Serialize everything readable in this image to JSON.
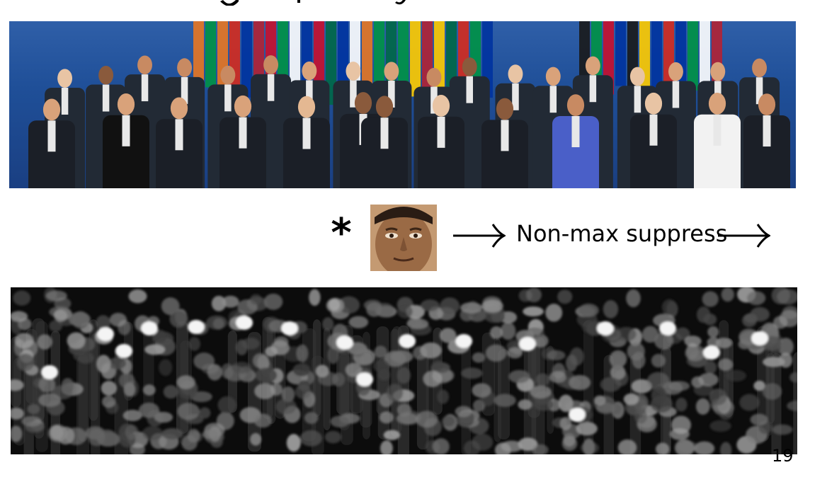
{
  "slide": {
    "heading_fragment": "g      p ,",
    "operator_symbol": "*",
    "nms_label": "Non-max suppress",
    "page_number": "19"
  },
  "figures": {
    "group_photo": {
      "subject": "group photo of leaders in front of national flags"
    },
    "template": {
      "subject": "face template close-up"
    },
    "response_map": {
      "subject": "grayscale filter response map with bright blobs"
    }
  },
  "icons": [
    "right-arrow-icon",
    "right-arrow-icon"
  ],
  "colors": {
    "photo_background": "#1f4f98",
    "response_background": "#0c0c0c",
    "text": "#000000"
  }
}
